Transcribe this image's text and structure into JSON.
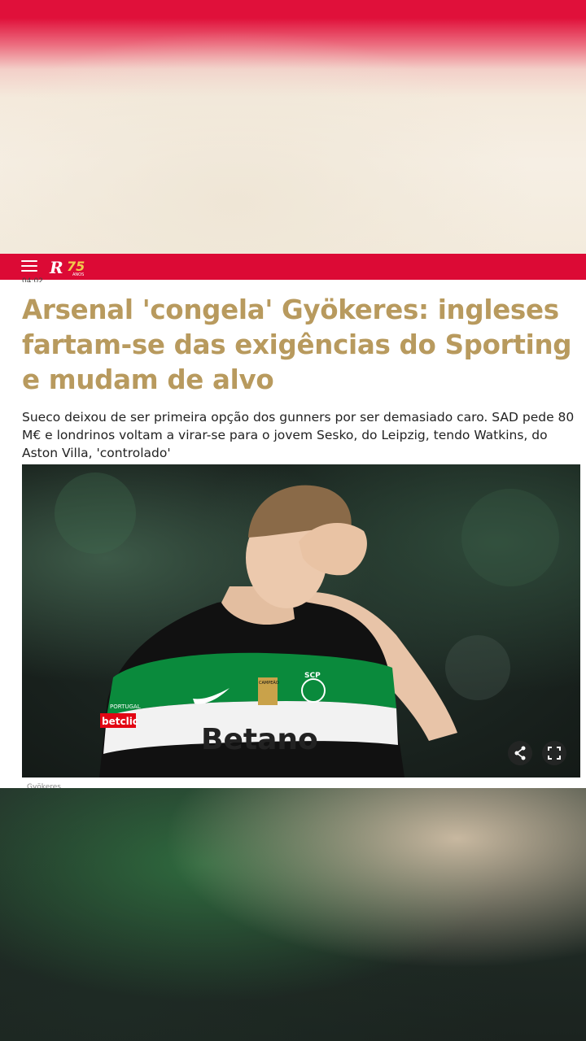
{
  "brand": {
    "logo_letter": "R",
    "anniversary_number": "75",
    "anniversary_word": "ANOS",
    "primary_color": "#dc0a35",
    "headline_color": "#b89a5e"
  },
  "nav": {
    "menu_icon": "hamburger-menu-icon"
  },
  "article": {
    "timestamp": "04:02",
    "headline": "Arsenal 'congela' Gyökeres: ingleses fartam-se das exigências do Sporting e mudam de alvo",
    "lead": "Sueco deixou de ser primeira opção dos gunners por ser demasiado caro. SAD pede 80 M€ e londrinos voltam a virar-se para o jovem Sesko, do Leipzig, tendo Watkins, do Aston Villa, 'controlado'",
    "photo": {
      "jersey_sponsor": "Betano",
      "badge_text": "CAMPEÃO",
      "crest_text": "SCP",
      "sleeve_text": "PORTUGAL",
      "sleeve_sponsor": "betclic",
      "share_icon": "share-icon",
      "fullscreen_icon": "fullscreen-icon"
    },
    "caption": "Gyökeres"
  }
}
